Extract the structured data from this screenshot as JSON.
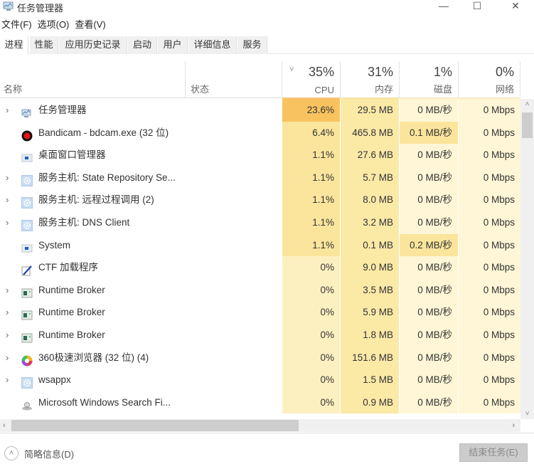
{
  "window": {
    "title": "任务管理器",
    "icon": "task-manager-icon",
    "controls": {
      "minimize": "—",
      "maximize": "☐",
      "close": "✕"
    }
  },
  "menu": [
    "文件(F)",
    "选项(O)",
    "查看(V)"
  ],
  "tabs": [
    {
      "label": "进程",
      "active": true
    },
    {
      "label": "性能",
      "active": false
    },
    {
      "label": "应用历史记录",
      "active": false
    },
    {
      "label": "启动",
      "active": false
    },
    {
      "label": "用户",
      "active": false
    },
    {
      "label": "详细信息",
      "active": false
    },
    {
      "label": "服务",
      "active": false
    }
  ],
  "columns": {
    "name": "名称",
    "status": "状态",
    "cpu": {
      "label": "CPU",
      "total": "35%"
    },
    "memory": {
      "label": "内存",
      "total": "31%"
    },
    "disk": {
      "label": "磁盘",
      "total": "1%"
    },
    "network": {
      "label": "网络",
      "total": "0%"
    },
    "sort_indicator": "˅"
  },
  "colors": {
    "heat_high": "#f8c35f",
    "heat_mid": "#fbe59c",
    "heat_low": "#fdf0c0",
    "heat_lowest": "#fef6d6",
    "mem_col": "#fbe9a6",
    "button_disabled_bg": "#cccccc"
  },
  "processes": [
    {
      "name": "任务管理器",
      "icon": "task-manager-icon",
      "expandable": true,
      "cpu": "23.6%",
      "memory": "29.5 MB",
      "disk": "0 MB/秒",
      "network": "0 Mbps",
      "heat": {
        "cpu": "high",
        "mem": "mid",
        "disk": "low",
        "net": "low"
      }
    },
    {
      "name": "Bandicam - bdcam.exe (32 位)",
      "icon": "bandicam-record-icon",
      "expandable": false,
      "cpu": "6.4%",
      "memory": "465.8 MB",
      "disk": "0.1 MB/秒",
      "network": "0 Mbps",
      "heat": {
        "cpu": "mid",
        "mem": "mid",
        "disk": "mid",
        "net": "low"
      }
    },
    {
      "name": "桌面窗口管理器",
      "icon": "system-window-icon",
      "expandable": false,
      "cpu": "1.1%",
      "memory": "27.6 MB",
      "disk": "0 MB/秒",
      "network": "0 Mbps",
      "heat": {
        "cpu": "mid",
        "mem": "mid",
        "disk": "low",
        "net": "low"
      }
    },
    {
      "name": "服务主机: State Repository Se...",
      "icon": "service-gear-icon",
      "expandable": true,
      "cpu": "1.1%",
      "memory": "5.7 MB",
      "disk": "0 MB/秒",
      "network": "0 Mbps",
      "heat": {
        "cpu": "mid",
        "mem": "mid",
        "disk": "low",
        "net": "low"
      }
    },
    {
      "name": "服务主机: 远程过程调用 (2)",
      "icon": "service-gear-icon",
      "expandable": true,
      "cpu": "1.1%",
      "memory": "8.0 MB",
      "disk": "0 MB/秒",
      "network": "0 Mbps",
      "heat": {
        "cpu": "mid",
        "mem": "mid",
        "disk": "low",
        "net": "low"
      }
    },
    {
      "name": "服务主机: DNS Client",
      "icon": "service-gear-icon",
      "expandable": true,
      "cpu": "1.1%",
      "memory": "3.2 MB",
      "disk": "0 MB/秒",
      "network": "0 Mbps",
      "heat": {
        "cpu": "mid",
        "mem": "mid",
        "disk": "low",
        "net": "low"
      }
    },
    {
      "name": "System",
      "icon": "system-window-icon",
      "expandable": false,
      "cpu": "1.1%",
      "memory": "0.1 MB",
      "disk": "0.2 MB/秒",
      "network": "0 Mbps",
      "heat": {
        "cpu": "mid",
        "mem": "mid",
        "disk": "mid",
        "net": "low"
      }
    },
    {
      "name": "CTF 加载程序",
      "icon": "ctf-pen-icon",
      "expandable": false,
      "cpu": "0%",
      "memory": "9.0 MB",
      "disk": "0 MB/秒",
      "network": "0 Mbps",
      "heat": {
        "cpu": "low",
        "mem": "mid",
        "disk": "low",
        "net": "low"
      }
    },
    {
      "name": "Runtime Broker",
      "icon": "runtime-broker-icon",
      "expandable": true,
      "cpu": "0%",
      "memory": "3.5 MB",
      "disk": "0 MB/秒",
      "network": "0 Mbps",
      "heat": {
        "cpu": "low",
        "mem": "mid",
        "disk": "low",
        "net": "low"
      }
    },
    {
      "name": "Runtime Broker",
      "icon": "runtime-broker-icon",
      "expandable": true,
      "cpu": "0%",
      "memory": "5.9 MB",
      "disk": "0 MB/秒",
      "network": "0 Mbps",
      "heat": {
        "cpu": "low",
        "mem": "mid",
        "disk": "low",
        "net": "low"
      }
    },
    {
      "name": "Runtime Broker",
      "icon": "runtime-broker-icon",
      "expandable": true,
      "cpu": "0%",
      "memory": "1.8 MB",
      "disk": "0 MB/秒",
      "network": "0 Mbps",
      "heat": {
        "cpu": "low",
        "mem": "mid",
        "disk": "low",
        "net": "low"
      }
    },
    {
      "name": "360极速浏览器 (32 位) (4)",
      "icon": "360-browser-icon",
      "expandable": true,
      "cpu": "0%",
      "memory": "151.6 MB",
      "disk": "0 MB/秒",
      "network": "0 Mbps",
      "heat": {
        "cpu": "low",
        "mem": "mid",
        "disk": "low",
        "net": "low"
      }
    },
    {
      "name": "wsappx",
      "icon": "service-gear-icon",
      "expandable": true,
      "cpu": "0%",
      "memory": "1.5 MB",
      "disk": "0 MB/秒",
      "network": "0 Mbps",
      "heat": {
        "cpu": "low",
        "mem": "mid",
        "disk": "low",
        "net": "low"
      }
    },
    {
      "name": "Microsoft Windows Search Fi...",
      "icon": "search-filter-icon",
      "expandable": false,
      "cpu": "0%",
      "memory": "0.9 MB",
      "disk": "0 MB/秒",
      "network": "0 Mbps",
      "heat": {
        "cpu": "low",
        "mem": "mid",
        "disk": "low",
        "net": "low"
      }
    }
  ],
  "scroll": {
    "up": "˄",
    "down": "˅",
    "left": "‹",
    "right": "›"
  },
  "footer": {
    "fewer_details": "简略信息(D)",
    "fewer_icon": "chevron-up-circle-icon",
    "end_task": "结束任务(E)"
  }
}
